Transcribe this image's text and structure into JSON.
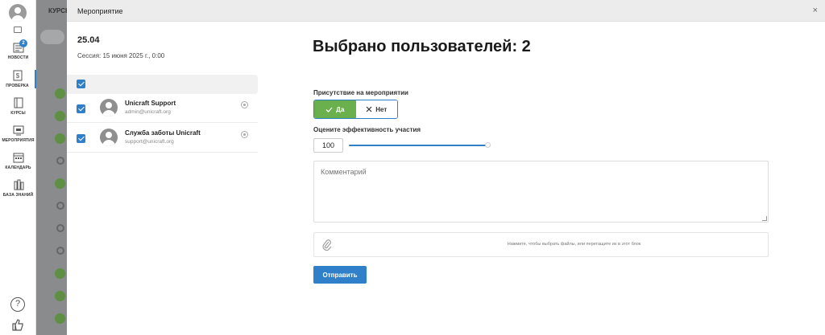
{
  "sidebar": {
    "items": [
      {
        "label": "НОВОСТИ",
        "badge": "2"
      },
      {
        "label": "ПРОВЕРКА"
      },
      {
        "label": "КУРСЫ"
      },
      {
        "label": "МЕРОПРИЯТИЯ"
      },
      {
        "label": "КАЛЕНДАРЬ"
      },
      {
        "label": "БАЗА ЗНАНИЙ"
      }
    ],
    "help_glyph": "?"
  },
  "background": {
    "tab_label": "КУРСЫ"
  },
  "modal": {
    "title": "Мероприятие",
    "close_glyph": "×",
    "date": "25.04",
    "session": "Сессия: 15 июня 2025 г., 0:00",
    "users": [
      {
        "name": "Unicraft Support",
        "email": "admin@unicraft.org"
      },
      {
        "name": "Служба заботы Unicraft",
        "email": "support@unicraft.org"
      }
    ],
    "heading": "Выбрано пользователей: 2",
    "presence_label": "Присутствие на мероприятии",
    "presence_yes": "Да",
    "presence_no": "Нет",
    "presence_value": "Да",
    "rating_label": "Оцените эффективность участия",
    "rating_value": "100",
    "comment_placeholder": "Комментарий",
    "dropzone_text": "Нажмите, чтобы выбрать файлы, или перетащите их в этот блок",
    "submit_label": "Отправить"
  },
  "colors": {
    "accent": "#2f80c8",
    "yes_green": "#6ab04c"
  }
}
